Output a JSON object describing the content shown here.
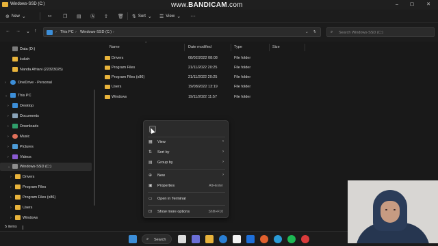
{
  "window": {
    "title": "Windows-SSD (C:)",
    "watermark_prefix": "www.",
    "watermark_brand": "BANDICAM",
    "watermark_suffix": ".com"
  },
  "toolbar": {
    "new_label": "New",
    "sort_label": "Sort",
    "view_label": "View",
    "more_label": "···"
  },
  "address": {
    "crumbs": [
      "This PC",
      "Windows-SSD (C:)"
    ],
    "search_placeholder": "Search Windows-SSD (C:)"
  },
  "sidebar": {
    "items": [
      {
        "label": "Data (D:)",
        "icon": "drive-icon"
      },
      {
        "label": "kuliah",
        "icon": "folder-icon"
      },
      {
        "label": "Nanda Afriani (22323025)",
        "icon": "folder-icon"
      },
      {
        "label": "OneDrive - Personal",
        "icon": "cloud-icon"
      },
      {
        "label": "This PC",
        "icon": "pc-icon"
      },
      {
        "label": "Desktop",
        "icon": "desktop-icon"
      },
      {
        "label": "Documents",
        "icon": "documents-icon"
      },
      {
        "label": "Downloads",
        "icon": "downloads-icon"
      },
      {
        "label": "Music",
        "icon": "music-icon"
      },
      {
        "label": "Pictures",
        "icon": "pictures-icon"
      },
      {
        "label": "Videos",
        "icon": "videos-icon"
      },
      {
        "label": "Windows-SSD (C:)",
        "icon": "drive-icon"
      },
      {
        "label": "Drivers",
        "icon": "folder-icon"
      },
      {
        "label": "Program Files",
        "icon": "folder-icon"
      },
      {
        "label": "Program Files (x86)",
        "icon": "folder-icon"
      },
      {
        "label": "Users",
        "icon": "folder-icon"
      },
      {
        "label": "Windows",
        "icon": "folder-icon"
      }
    ]
  },
  "columns": {
    "name": "Name",
    "date": "Date modified",
    "type": "Type",
    "size": "Size"
  },
  "files": [
    {
      "name": "Drivers",
      "date": "08/02/2022 08:08",
      "type": "File folder"
    },
    {
      "name": "Program Files",
      "date": "21/11/2022 20:25",
      "type": "File folder"
    },
    {
      "name": "Program Files (x86)",
      "date": "21/11/2022 20:25",
      "type": "File folder"
    },
    {
      "name": "Users",
      "date": "19/08/2022 13:19",
      "type": "File folder"
    },
    {
      "name": "Windows",
      "date": "19/11/2022 11:57",
      "type": "File folder"
    }
  ],
  "context_menu": {
    "view": "View",
    "sort_by": "Sort by",
    "group_by": "Group by",
    "new": "New",
    "properties": "Properties",
    "properties_shortcut": "Alt+Enter",
    "open_terminal": "Open in Terminal",
    "more_options": "Show more options",
    "more_options_shortcut": "Shift+F10"
  },
  "status": {
    "items_count": "5 items"
  },
  "taskbar": {
    "search_label": "Search"
  },
  "colors": {
    "folder": "#e8b33b",
    "background": "#191919",
    "menu": "#2b2b2b"
  }
}
